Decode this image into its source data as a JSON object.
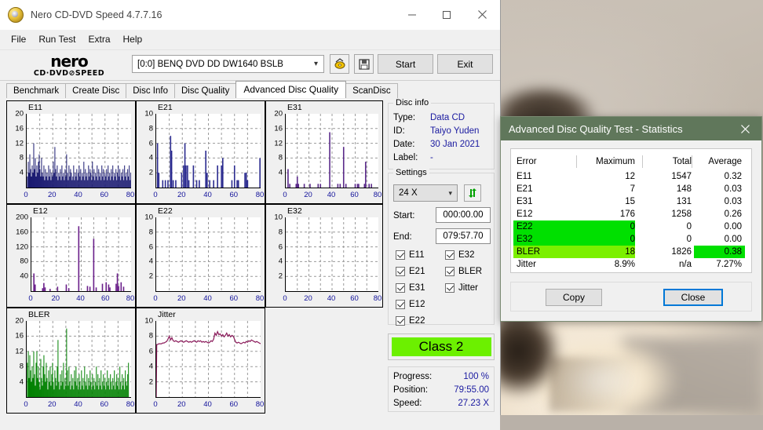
{
  "window": {
    "title": "Nero CD-DVD Speed 4.7.7.16",
    "minimize": "minimize-icon",
    "maximize": "maximize-icon",
    "close": "close-icon"
  },
  "menu": {
    "items": [
      "File",
      "Run Test",
      "Extra",
      "Help"
    ]
  },
  "toolbar": {
    "logo_line1": "nero",
    "logo_line2": "CD·DVD⊘SPEED",
    "drive": "[0:0]   BENQ DVD DD DW1640 BSLB",
    "refresh_icon": "disc-refresh-icon",
    "save_icon": "floppy-save-icon",
    "start_label": "Start",
    "exit_label": "Exit"
  },
  "tabs": {
    "items": [
      "Benchmark",
      "Create Disc",
      "Disc Info",
      "Disc Quality",
      "Advanced Disc Quality",
      "ScanDisc"
    ],
    "active": "Advanced Disc Quality"
  },
  "disc_info": {
    "legend": "Disc info",
    "rows": [
      {
        "key": "Type:",
        "value": "Data CD"
      },
      {
        "key": "ID:",
        "value": "Taiyo Yuden"
      },
      {
        "key": "Date:",
        "value": "30 Jan 2021"
      },
      {
        "key": "Label:",
        "value": "-"
      }
    ]
  },
  "settings": {
    "legend": "Settings",
    "speed": "24 X",
    "refresh_icon": "refresh-arrows-icon",
    "start_label": "Start:",
    "start_value": "000:00.00",
    "end_label": "End:",
    "end_value": "079:57.70",
    "checkboxes": [
      {
        "label": "E11",
        "checked": true
      },
      {
        "label": "E21",
        "checked": true
      },
      {
        "label": "E31",
        "checked": true
      },
      {
        "label": "E12",
        "checked": true
      },
      {
        "label": "E22",
        "checked": true
      },
      {
        "label": "E32",
        "checked": true
      },
      {
        "label": "BLER",
        "checked": true
      },
      {
        "label": "Jitter",
        "checked": true
      }
    ]
  },
  "class_result": {
    "label": "Class 2",
    "color": "#6cf000"
  },
  "status": {
    "rows": [
      {
        "key": "Progress:",
        "value": "100 %"
      },
      {
        "key": "Position:",
        "value": "79:55.00"
      },
      {
        "key": "Speed:",
        "value": "27.23 X"
      }
    ]
  },
  "dialog": {
    "title": "Advanced Disc Quality Test - Statistics",
    "close_icon": "close-icon",
    "columns": [
      "Error",
      "Maximum",
      "Total",
      "Average"
    ],
    "rows": [
      {
        "error": "E11",
        "maximum": "12",
        "total": "1547",
        "average": "0.32",
        "highlight": "none"
      },
      {
        "error": "E21",
        "maximum": "7",
        "total": "148",
        "average": "0.03",
        "highlight": "none"
      },
      {
        "error": "E31",
        "maximum": "15",
        "total": "131",
        "average": "0.03",
        "highlight": "none"
      },
      {
        "error": "E12",
        "maximum": "176",
        "total": "1258",
        "average": "0.26",
        "highlight": "none"
      },
      {
        "error": "E22",
        "maximum": "0",
        "total": "0",
        "average": "0.00",
        "highlight": "green-left"
      },
      {
        "error": "E32",
        "maximum": "0",
        "total": "0",
        "average": "0.00",
        "highlight": "green-left"
      },
      {
        "error": "BLER",
        "maximum": "18",
        "total": "1826",
        "average": "0.38",
        "highlight": "lgreen-left-green-avg"
      },
      {
        "error": "Jitter",
        "maximum": "8.9%",
        "total": "n/a",
        "average": "7.27%",
        "highlight": "none"
      }
    ],
    "copy_label": "Copy",
    "close_label": "Close"
  },
  "chart_data": [
    {
      "type": "bar",
      "title": "E11",
      "color": "#191970",
      "xlabel": "",
      "ylabel": "",
      "xlim": [
        0,
        80
      ],
      "ylim": [
        0,
        20
      ],
      "xticks": [
        0,
        20,
        40,
        60,
        80
      ],
      "yticks": [
        4,
        8,
        12,
        16,
        20
      ],
      "grid": true,
      "x": [
        0.5,
        1.2,
        1.8,
        2.4,
        3,
        3.6,
        4.2,
        4.8,
        5.4,
        6,
        6.6,
        7.2,
        7.8,
        8.4,
        9,
        9.6,
        10.2,
        10.8,
        11.4,
        12,
        12.6,
        13.2,
        13.8,
        14.4,
        15,
        15.6,
        16.2,
        16.8,
        17.4,
        18,
        18.6,
        19.2,
        19.8,
        20.4,
        21,
        21.6,
        22.2,
        22.8,
        23.4,
        24,
        24.6,
        25.2,
        25.8,
        26.4,
        27,
        27.6,
        28.2,
        28.8,
        29.4,
        30,
        30.6,
        31.2,
        31.8,
        32.4,
        33,
        33.6,
        34.2,
        34.8,
        35.4,
        36,
        36.6,
        37.2,
        37.8,
        38.4,
        39,
        39.6,
        40.2,
        40.8,
        41.4,
        42,
        42.6,
        43.2,
        43.8,
        44.4,
        45,
        45.6,
        46.2,
        46.8,
        47.4,
        48,
        48.6,
        49.2,
        49.8,
        50.4,
        51,
        51.6,
        52.2,
        52.8,
        53.4,
        54,
        54.6,
        55.2,
        55.8,
        56.4,
        57,
        57.6,
        58.2,
        58.8,
        59.4,
        60,
        60.6,
        61.2,
        61.8,
        62.4,
        63,
        63.6,
        64.2,
        64.8,
        65.4,
        66,
        66.6,
        67.2,
        67.8,
        68.4,
        69,
        69.6,
        70.2,
        70.8,
        71.4,
        72,
        72.6,
        73.2,
        73.8,
        74.4,
        75,
        75.6,
        76.2,
        76.8,
        77.4,
        78,
        78.6,
        79.2,
        79.8
      ],
      "values": [
        3,
        7,
        4,
        9,
        5,
        3,
        6,
        4,
        12,
        5,
        8,
        3,
        6,
        4,
        7,
        9,
        5,
        3,
        8,
        4,
        3,
        6,
        2,
        5,
        3,
        4,
        2,
        6,
        3,
        5,
        2,
        4,
        3,
        7,
        4,
        11,
        5,
        3,
        6,
        2,
        4,
        3,
        5,
        2,
        6,
        3,
        4,
        2,
        5,
        3,
        9,
        4,
        2,
        6,
        3,
        5,
        4,
        2,
        3,
        6,
        2,
        4,
        3,
        5,
        2,
        4,
        6,
        3,
        5,
        2,
        4,
        3,
        7,
        2,
        5,
        3,
        4,
        2,
        6,
        3,
        5,
        4,
        2,
        7,
        3,
        5,
        2,
        4,
        3,
        6,
        2,
        5,
        3,
        4,
        2,
        6,
        3,
        5,
        2,
        4,
        3,
        5,
        2,
        6,
        3,
        4,
        2,
        5,
        3,
        6,
        2,
        4,
        3,
        5,
        2,
        4,
        6,
        3,
        5,
        2,
        4,
        3,
        5,
        2,
        6,
        3,
        4,
        2,
        5,
        3,
        6,
        2,
        4,
        6
      ],
      "ymax_observed": 12
    },
    {
      "type": "bar",
      "title": "E21",
      "color": "#2b2b8f",
      "xlabel": "",
      "ylabel": "",
      "xlim": [
        0,
        80
      ],
      "ylim": [
        0,
        10
      ],
      "xticks": [
        0,
        20,
        40,
        60,
        80
      ],
      "yticks": [
        2,
        4,
        6,
        8,
        10
      ],
      "grid": true,
      "x": [
        1,
        2,
        5,
        7,
        9,
        11,
        11.8,
        13,
        15,
        19.5,
        21,
        22,
        22.8,
        24,
        25,
        28.5,
        31,
        33,
        38,
        39,
        41,
        44,
        47,
        50,
        51,
        58,
        60,
        62,
        63,
        68,
        69,
        70,
        79.5
      ],
      "values": [
        6,
        2,
        1,
        1,
        1,
        7,
        5,
        1,
        1,
        2,
        3,
        6,
        3,
        3,
        1,
        3,
        1,
        1,
        5,
        2,
        1,
        1,
        3,
        3,
        4,
        1,
        3,
        1,
        1,
        2,
        2,
        1,
        4
      ],
      "ymax_observed": 7
    },
    {
      "type": "bar",
      "title": "E31",
      "color": "#5a2a8a",
      "xlabel": "",
      "ylabel": "",
      "xlim": [
        0,
        80
      ],
      "ylim": [
        0,
        20
      ],
      "xticks": [
        0,
        20,
        40,
        60,
        80
      ],
      "yticks": [
        4,
        8,
        12,
        16,
        20
      ],
      "grid": true,
      "x": [
        2,
        3.5,
        9,
        10,
        11,
        16,
        21,
        28,
        30,
        38,
        45,
        47,
        50,
        52,
        60,
        62,
        63,
        68,
        69,
        72,
        74
      ],
      "values": [
        5,
        1,
        1,
        3,
        1,
        1,
        1,
        1,
        1,
        15,
        1,
        1,
        11,
        1,
        1,
        1,
        1,
        1,
        7,
        1,
        1
      ],
      "ymax_observed": 15
    },
    {
      "type": "bar",
      "title": "E12",
      "color": "#6a1f8a",
      "xlabel": "",
      "ylabel": "",
      "xlim": [
        0,
        80
      ],
      "ylim": [
        0,
        200
      ],
      "xticks": [
        0,
        20,
        40,
        60,
        80
      ],
      "yticks": [
        40,
        80,
        120,
        160,
        200
      ],
      "grid": true,
      "x": [
        2,
        3,
        9,
        10,
        11,
        15,
        21,
        28,
        30,
        38,
        45,
        47,
        50,
        52,
        57,
        60,
        62,
        63,
        68,
        69,
        70,
        72,
        74
      ],
      "values": [
        48,
        18,
        8,
        22,
        10,
        6,
        12,
        18,
        8,
        176,
        14,
        12,
        142,
        10,
        20,
        24,
        18,
        10,
        20,
        48,
        14,
        24,
        12
      ],
      "ymax_observed": 176
    },
    {
      "type": "bar",
      "title": "E22",
      "color": "#2b2b8f",
      "xlabel": "",
      "ylabel": "",
      "xlim": [
        0,
        80
      ],
      "ylim": [
        0,
        10
      ],
      "xticks": [
        0,
        20,
        40,
        60,
        80
      ],
      "yticks": [
        2,
        4,
        6,
        8,
        10
      ],
      "grid": true,
      "x": [],
      "values": [],
      "ymax_observed": 0
    },
    {
      "type": "bar",
      "title": "E32",
      "color": "#2b2b8f",
      "xlabel": "",
      "ylabel": "",
      "xlim": [
        0,
        80
      ],
      "ylim": [
        0,
        10
      ],
      "xticks": [
        0,
        20,
        40,
        60,
        80
      ],
      "yticks": [
        2,
        4,
        6,
        8,
        10
      ],
      "grid": true,
      "x": [],
      "values": [],
      "ymax_observed": 0
    },
    {
      "type": "bar",
      "title": "BLER",
      "color": "#008000",
      "xlabel": "",
      "ylabel": "",
      "xlim": [
        0,
        80
      ],
      "ylim": [
        0,
        20
      ],
      "xticks": [
        0,
        20,
        40,
        60,
        80
      ],
      "yticks": [
        4,
        8,
        12,
        16,
        20
      ],
      "grid": true,
      "x": [
        0.5,
        1.2,
        1.8,
        2.4,
        3,
        3.6,
        4.2,
        4.8,
        5.4,
        6,
        6.6,
        7.2,
        7.8,
        8.4,
        9,
        9.6,
        10.2,
        10.8,
        11.4,
        12,
        12.6,
        13.2,
        13.8,
        14.4,
        15,
        15.6,
        16.2,
        16.8,
        17.4,
        18,
        18.6,
        19.2,
        19.8,
        20.4,
        21,
        21.6,
        22.2,
        22.8,
        23.4,
        24,
        24.6,
        25.2,
        25.8,
        26.4,
        27,
        27.6,
        28.2,
        28.8,
        29.4,
        30,
        30.6,
        31.2,
        31.8,
        32.4,
        33,
        33.6,
        34.2,
        34.8,
        35.4,
        36,
        36.6,
        37.2,
        37.8,
        38.4,
        39,
        39.6,
        40.2,
        40.8,
        41.4,
        42,
        42.6,
        43.2,
        43.8,
        44.4,
        45,
        45.6,
        46.2,
        46.8,
        47.4,
        48,
        48.6,
        49.2,
        49.8,
        50.4,
        51,
        51.6,
        52.2,
        52.8,
        53.4,
        54,
        54.6,
        55.2,
        55.8,
        56.4,
        57,
        57.6,
        58.2,
        58.8,
        59.4,
        60,
        60.6,
        61.2,
        61.8,
        62.4,
        63,
        63.6,
        64.2,
        64.8,
        65.4,
        66,
        66.6,
        67.2,
        67.8,
        68.4,
        69,
        69.6,
        70.2,
        70.8,
        71.4,
        72,
        72.6,
        73.2,
        73.8,
        74.4,
        75,
        75.6,
        76.2,
        76.8,
        77.4,
        78,
        78.6,
        79.2,
        79.8
      ],
      "values": [
        9,
        12,
        5,
        11,
        7,
        4,
        8,
        5,
        12,
        6,
        3,
        9,
        12,
        5,
        8,
        4,
        2,
        10,
        5,
        3,
        8,
        11,
        6,
        4,
        9,
        5,
        2,
        7,
        4,
        8,
        3,
        6,
        9,
        4,
        2,
        7,
        5,
        3,
        8,
        15,
        4,
        2,
        6,
        3,
        7,
        4,
        9,
        2,
        5,
        3,
        18,
        7,
        3,
        8,
        4,
        2,
        6,
        3,
        5,
        2,
        7,
        4,
        8,
        3,
        5,
        2,
        6,
        4,
        2,
        7,
        3,
        5,
        2,
        8,
        4,
        3,
        6,
        2,
        5,
        3,
        7,
        4,
        2,
        6,
        3,
        5,
        2,
        4,
        8,
        3,
        6,
        2,
        5,
        3,
        7,
        2,
        4,
        6,
        3,
        5,
        2,
        4,
        7,
        3,
        5,
        2,
        6,
        4,
        2,
        5,
        3,
        7,
        2,
        4,
        6,
        3,
        5,
        2,
        8,
        4,
        2,
        6,
        3,
        5,
        2,
        7,
        4,
        3,
        6,
        9
      ],
      "ymax_observed": 18
    },
    {
      "type": "line",
      "title": "Jitter",
      "color": "#8a1a5a",
      "xlabel": "",
      "ylabel": "",
      "xlim": [
        0,
        80
      ],
      "ylim": [
        0,
        10
      ],
      "xticks": [
        0,
        20,
        40,
        60,
        80
      ],
      "yticks": [
        2,
        4,
        6,
        8,
        10
      ],
      "grid": true,
      "x": [
        0,
        0.4,
        1,
        2,
        3,
        4,
        5,
        6,
        7,
        8,
        9,
        10,
        11,
        12,
        13,
        14,
        15,
        16,
        17,
        18,
        19,
        20,
        21,
        22,
        23,
        24,
        25,
        26,
        27,
        28,
        29,
        30,
        31,
        32,
        33,
        34,
        35,
        36,
        37,
        38,
        39,
        40,
        41,
        42,
        43,
        44,
        45,
        46,
        47,
        48,
        49,
        50,
        51,
        52,
        53,
        54,
        55,
        56,
        57,
        58,
        59,
        60,
        61,
        62,
        63,
        64,
        65,
        66,
        67,
        68,
        69,
        70,
        71,
        72,
        73,
        74,
        75,
        76,
        77,
        78,
        79,
        80
      ],
      "values": [
        0,
        6.9,
        6.9,
        7.0,
        7.0,
        7.0,
        7.1,
        7.1,
        7.2,
        7.3,
        7.6,
        8.0,
        7.5,
        7.8,
        7.4,
        7.3,
        7.4,
        7.3,
        7.2,
        7.3,
        7.4,
        7.3,
        7.2,
        7.3,
        7.4,
        7.3,
        7.2,
        7.3,
        7.2,
        7.3,
        7.4,
        7.3,
        7.2,
        7.4,
        7.3,
        7.4,
        7.2,
        7.3,
        7.2,
        7.3,
        7.2,
        7.1,
        7.2,
        7.4,
        7.3,
        7.6,
        8.4,
        8.1,
        8.6,
        8.2,
        8.3,
        8.0,
        8.2,
        7.9,
        8.1,
        8.4,
        8.0,
        8.2,
        7.9,
        8.1,
        8.0,
        7.6,
        7.2,
        7.1,
        7.2,
        7.1,
        7.0,
        7.1,
        7.2,
        7.1,
        7.3,
        7.2,
        7.4,
        7.3,
        7.5,
        7.4,
        7.3,
        7.2,
        7.3,
        7.2,
        7.1,
        7.0
      ],
      "ymax_observed": 8.9
    }
  ]
}
